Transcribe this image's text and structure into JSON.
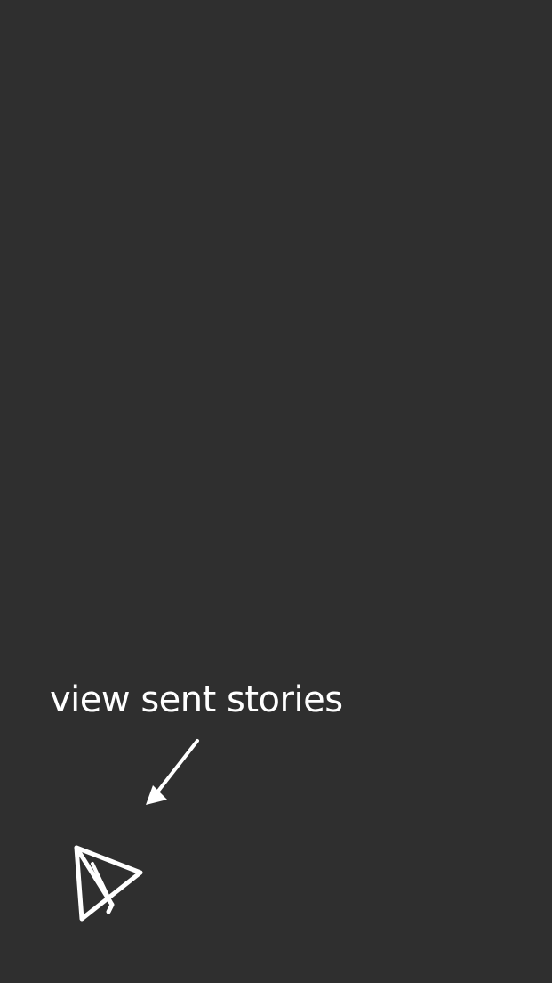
{
  "hint": {
    "label": "view sent stories"
  },
  "icons": {
    "arrow": "arrow-down-left-icon",
    "sent": "paper-plane-icon"
  },
  "colors": {
    "background": "#2f2f2f",
    "foreground": "#ffffff"
  }
}
